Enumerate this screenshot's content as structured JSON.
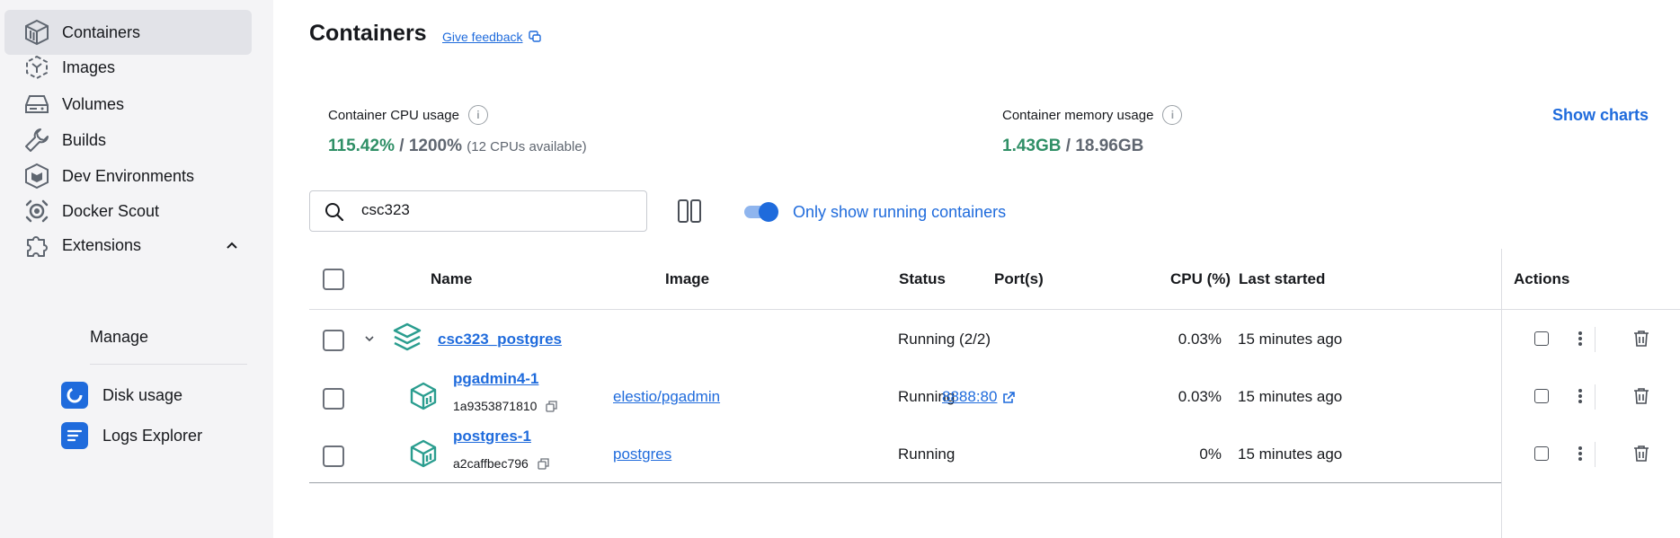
{
  "sidebar": {
    "items": [
      {
        "label": "Containers",
        "icon": "container-icon"
      },
      {
        "label": "Images",
        "icon": "image-icon"
      },
      {
        "label": "Volumes",
        "icon": "volume-icon"
      },
      {
        "label": "Builds",
        "icon": "wrench-icon"
      },
      {
        "label": "Dev Environments",
        "icon": "dev-env-icon"
      },
      {
        "label": "Docker Scout",
        "icon": "scout-icon"
      },
      {
        "label": "Extensions",
        "icon": "puzzle-icon"
      }
    ],
    "manage_label": "Manage",
    "extensions": [
      {
        "label": "Disk usage",
        "icon": "disk-usage-icon"
      },
      {
        "label": "Logs Explorer",
        "icon": "logs-explorer-icon"
      }
    ]
  },
  "header": {
    "title": "Containers",
    "feedback": "Give feedback"
  },
  "stats": {
    "cpu_label": "Container CPU usage",
    "cpu_used": "115.42%",
    "cpu_sep": " / ",
    "cpu_total": "1200%",
    "cpu_note": "(12 CPUs available)",
    "mem_label": "Container memory usage",
    "mem_used": "1.43GB",
    "mem_sep": " / ",
    "mem_total": "18.96GB",
    "show_charts": "Show charts"
  },
  "search": {
    "value": "csc323"
  },
  "filter": {
    "toggle_label": "Only show running containers",
    "toggle_on": true
  },
  "table": {
    "headers": {
      "name": "Name",
      "image": "Image",
      "status": "Status",
      "ports": "Port(s)",
      "cpu": "CPU (%)",
      "last_started": "Last started",
      "actions": "Actions"
    },
    "group": {
      "name": "csc323_postgres",
      "status": "Running (2/2)",
      "cpu": "0.03%",
      "last_started": "15 minutes ago"
    },
    "rows": [
      {
        "name": "pgadmin4-1",
        "id": "1a9353871810",
        "image": "elestio/pgadmin",
        "status": "Running",
        "port": "8888:80",
        "cpu": "0.03%",
        "last_started": "15 minutes ago"
      },
      {
        "name": "postgres-1",
        "id": "a2caffbec796",
        "image": "postgres",
        "status": "Running",
        "port": "",
        "cpu": "0%",
        "last_started": "15 minutes ago"
      }
    ]
  },
  "colors": {
    "accent": "#1f6bdc",
    "green": "#2f8f66",
    "sidebar_bg": "#f4f4f6",
    "container_teal": "#2a9d8f"
  }
}
